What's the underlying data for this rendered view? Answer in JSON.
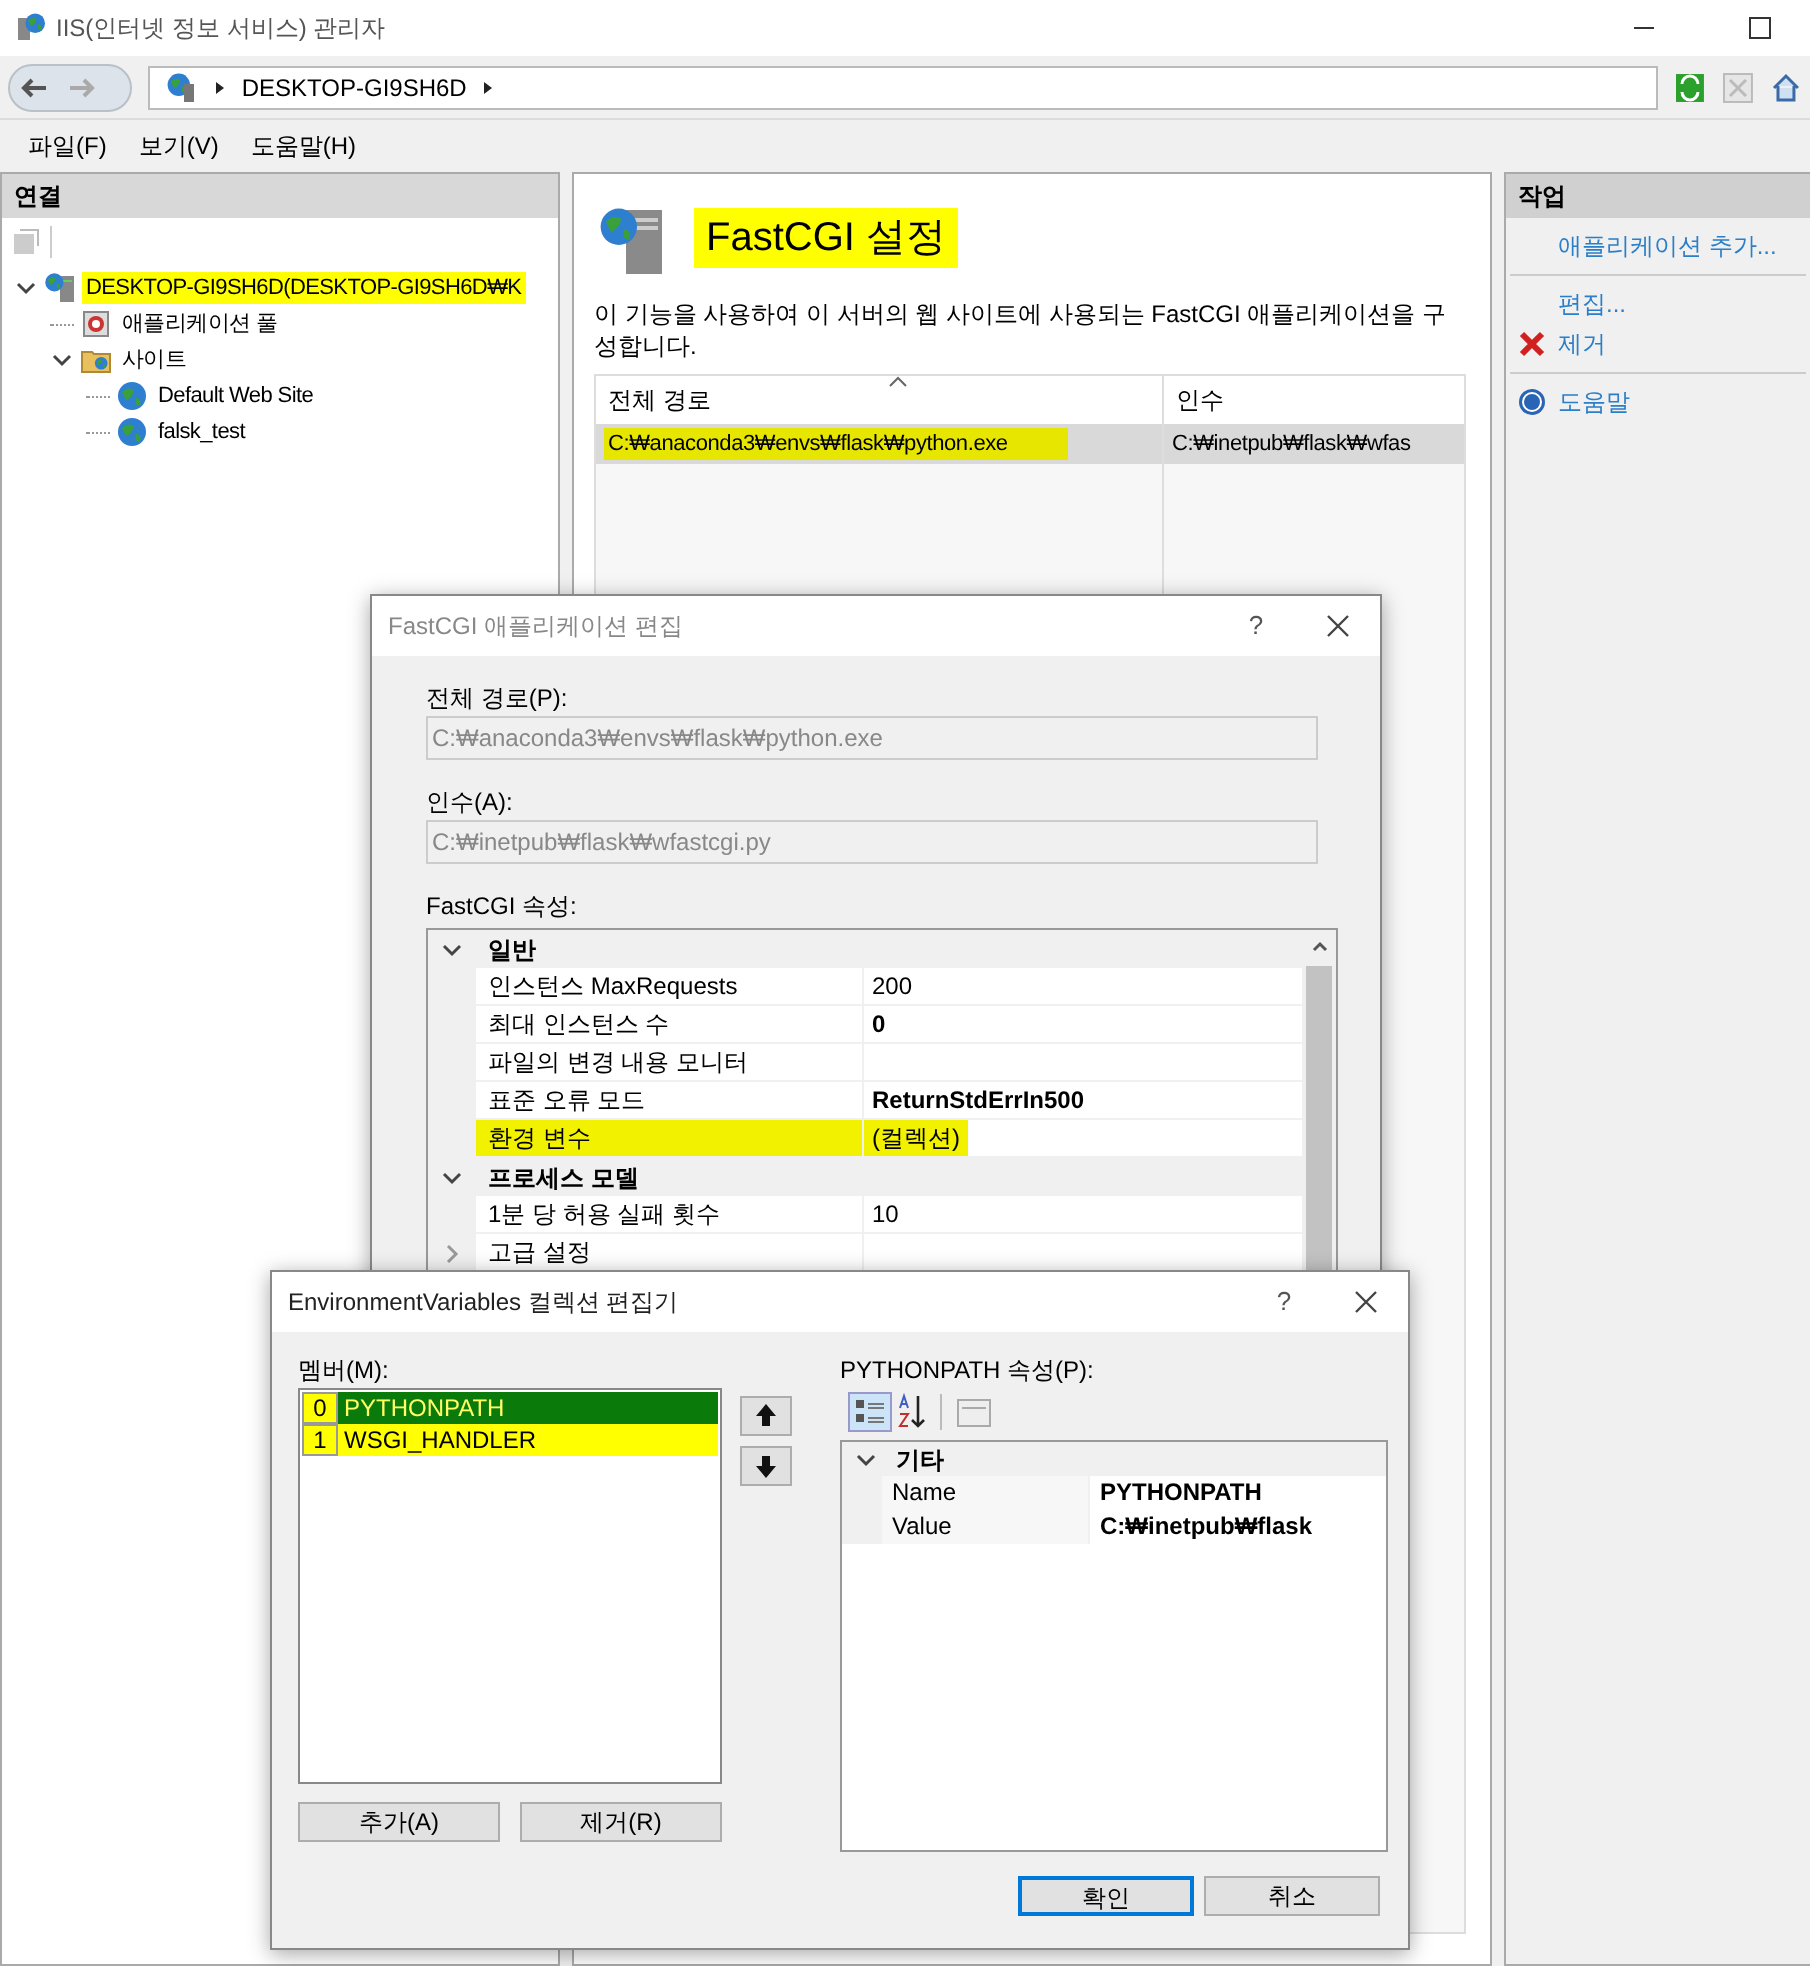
{
  "window": {
    "title": "IIS(인터넷 정보 서비스) 관리자"
  },
  "address_bar": {
    "segments": [
      "DESKTOP-GI9SH6D"
    ]
  },
  "menu": [
    "파일(F)",
    "보기(V)",
    "도움말(H)"
  ],
  "connections": {
    "title": "연결",
    "tree": [
      {
        "label": "DESKTOP-GI9SH6D(DESKTOP-GI9SH6D₩K",
        "kind": "server",
        "expanded": true,
        "highlighted": true,
        "children": [
          {
            "label": "애플리케이션 풀",
            "kind": "pool",
            "highlighted": false
          },
          {
            "label": "사이트",
            "kind": "folder",
            "expanded": true,
            "highlighted": false,
            "children": [
              {
                "label": "Default Web Site",
                "kind": "site",
                "highlighted": false
              },
              {
                "label": "falsk_test",
                "kind": "site",
                "highlighted": false
              }
            ]
          }
        ]
      }
    ]
  },
  "feature": {
    "title": "FastCGI 설정",
    "title_highlighted": true,
    "description": "이 기능을 사용하여 이 서버의 웹 사이트에 사용되는 FastCGI 애플리케이션을 구성합니다.",
    "table": {
      "columns": [
        "전체 경로",
        "인수"
      ],
      "rows": [
        {
          "cells": [
            "C:₩anaconda3₩envs₩flask₩python.exe",
            "C:₩inetpub₩flask₩wfas"
          ],
          "selected": true,
          "highlighted": true
        }
      ]
    }
  },
  "actions": {
    "title": "작업",
    "items": [
      {
        "label": "애플리케이션 추가...",
        "kind": "link"
      },
      {
        "kind": "separator"
      },
      {
        "label": "편집...",
        "kind": "link"
      },
      {
        "label": "제거",
        "kind": "remove"
      },
      {
        "kind": "separator"
      },
      {
        "label": "도움말",
        "kind": "help"
      }
    ]
  },
  "edit_dialog": {
    "title": "FastCGI 애플리케이션 편집",
    "help": "?",
    "path_label": "전체 경로(P):",
    "path_value": "C:₩anaconda3₩envs₩flask₩python.exe",
    "args_label": "인수(A):",
    "args_value": "C:₩inetpub₩flask₩wfastcgi.py",
    "props_label": "FastCGI 속성:",
    "categories": [
      {
        "name": "일반",
        "expanded": true,
        "rows": [
          {
            "name": "인스턴스 MaxRequests",
            "value": "200",
            "highlighted": false
          },
          {
            "name": "최대 인스턴스 수",
            "value": "0",
            "bold": true,
            "highlighted": false
          },
          {
            "name": "파일의 변경 내용 모니터",
            "highlighted": false
          },
          {
            "name": "표준 오류 모드",
            "value": "ReturnStdErrIn500",
            "bold": true,
            "highlighted": false
          },
          {
            "name": "환경 변수",
            "value": "(컬렉션)",
            "highlighted": true
          }
        ]
      },
      {
        "name": "프로세스 모델",
        "expanded": true,
        "rows": [
          {
            "name": "1분 당 허용 실패 횟수",
            "value": "10",
            "highlighted": false
          },
          {
            "name": "고급 설정",
            "expandable": true,
            "highlighted": false
          }
        ]
      }
    ]
  },
  "collection_dialog": {
    "title": "EnvironmentVariables 컬렉션 편집기",
    "help": "?",
    "members_label": "멤버(M):",
    "members": [
      {
        "index": "0",
        "name": "PYTHONPATH",
        "selected": true,
        "highlighted": true
      },
      {
        "index": "1",
        "name": "WSGI_HANDLER",
        "selected": false,
        "highlighted": true
      }
    ],
    "props_label": "PYTHONPATH 속성(P):",
    "category": "기타",
    "properties": [
      {
        "name": "Name",
        "value": "PYTHONPATH"
      },
      {
        "name": "Value",
        "value": "C:₩inetpub₩flask"
      }
    ],
    "add": "추가(A)",
    "remove": "제거(R)",
    "ok": "확인",
    "cancel": "취소"
  }
}
